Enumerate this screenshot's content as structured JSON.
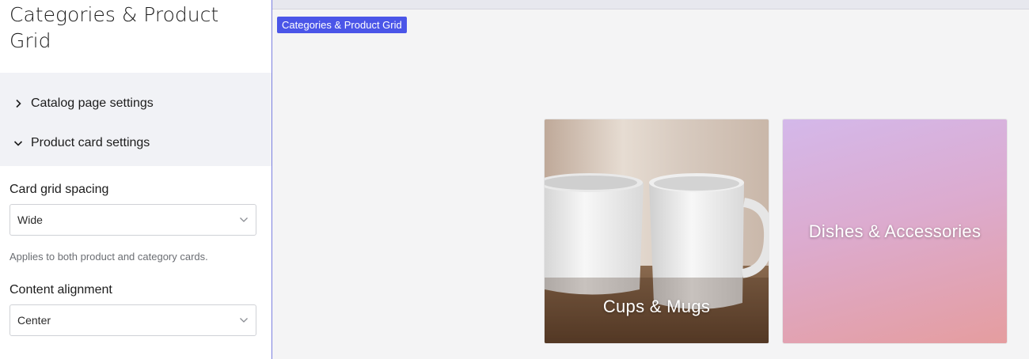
{
  "panel": {
    "title": "Categories & Product Grid",
    "sections": [
      {
        "label": "Catalog page settings",
        "expanded": false,
        "icon": "chevron-right-icon"
      },
      {
        "label": "Product card settings",
        "expanded": true,
        "icon": "chevron-down-icon"
      }
    ],
    "card_grid_spacing": {
      "label": "Card grid spacing",
      "value": "Wide",
      "help": "Applies to both product and category cards."
    },
    "content_alignment": {
      "label": "Content alignment",
      "value": "Center"
    }
  },
  "preview": {
    "tag_label": "Categories & Product Grid",
    "cards": [
      {
        "title": "Cups & Mugs"
      },
      {
        "title": "Dishes & Accessories"
      }
    ]
  },
  "colors": {
    "accent": "#4a55e8",
    "divider": "#7b7fe0",
    "section_bg": "#f1f2f6",
    "preview_bg": "#f4f4f5"
  }
}
